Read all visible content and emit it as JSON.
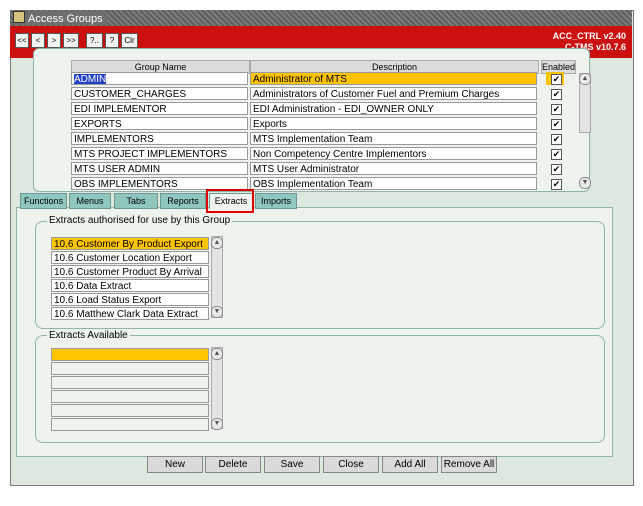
{
  "window": {
    "title": "Access Groups",
    "code_line1": "ACC_CTRL v2.40",
    "code_line2": "C-TMS v10.7.6"
  },
  "toolbar": {
    "buttons": [
      "<<",
      "<",
      ">",
      ">>",
      "?..",
      "?",
      "Clr"
    ]
  },
  "groups_table": {
    "columns": [
      "Group Name",
      "Description",
      "Enabled"
    ],
    "rows": [
      {
        "name": "ADMIN",
        "description": "Administrator of MTS",
        "enabled": true
      },
      {
        "name": "CUSTOMER_CHARGES",
        "description": "Administrators of Customer Fuel and Premium Charges",
        "enabled": true
      },
      {
        "name": "EDI IMPLEMENTOR",
        "description": "EDI Administration - EDI_OWNER ONLY",
        "enabled": true
      },
      {
        "name": "EXPORTS",
        "description": "Exports",
        "enabled": true
      },
      {
        "name": "IMPLEMENTORS",
        "description": "MTS Implementation Team",
        "enabled": true
      },
      {
        "name": "MTS PROJECT IMPLEMENTORS",
        "description": "Non Competency Centre Implementors",
        "enabled": true
      },
      {
        "name": "MTS USER ADMIN",
        "description": "MTS User Administrator",
        "enabled": true
      },
      {
        "name": "OBS IMPLEMENTORS",
        "description": "OBS Implementation Team",
        "enabled": true
      }
    ],
    "selected_index": 0
  },
  "tabs": [
    "Functions",
    "Menus",
    "Tabs",
    "Reports",
    "Extracts",
    "Imports"
  ],
  "active_tab": "Extracts",
  "authorised": {
    "label": "Extracts authorised for use by this Group",
    "items": [
      "10.6 Customer By Product Export",
      "10.6 Customer Location Export",
      "10.6 Customer Product By Arrival",
      "10.6 Data Extract",
      "10.6 Load Status Export",
      "10.6 Matthew Clark Data Extract"
    ]
  },
  "available": {
    "label": "Extracts Available",
    "items": [
      "",
      "",
      "",
      "",
      "",
      ""
    ]
  },
  "buttons": {
    "new": "New",
    "delete": "Delete",
    "save": "Save",
    "close": "Close",
    "add_all": "Add All",
    "remove_all": "Remove All"
  },
  "colors": {
    "toolbar": "#cc1010",
    "selection": "#ffc400",
    "tab": "#8fc7bf",
    "highlight_box": "#e00000"
  }
}
